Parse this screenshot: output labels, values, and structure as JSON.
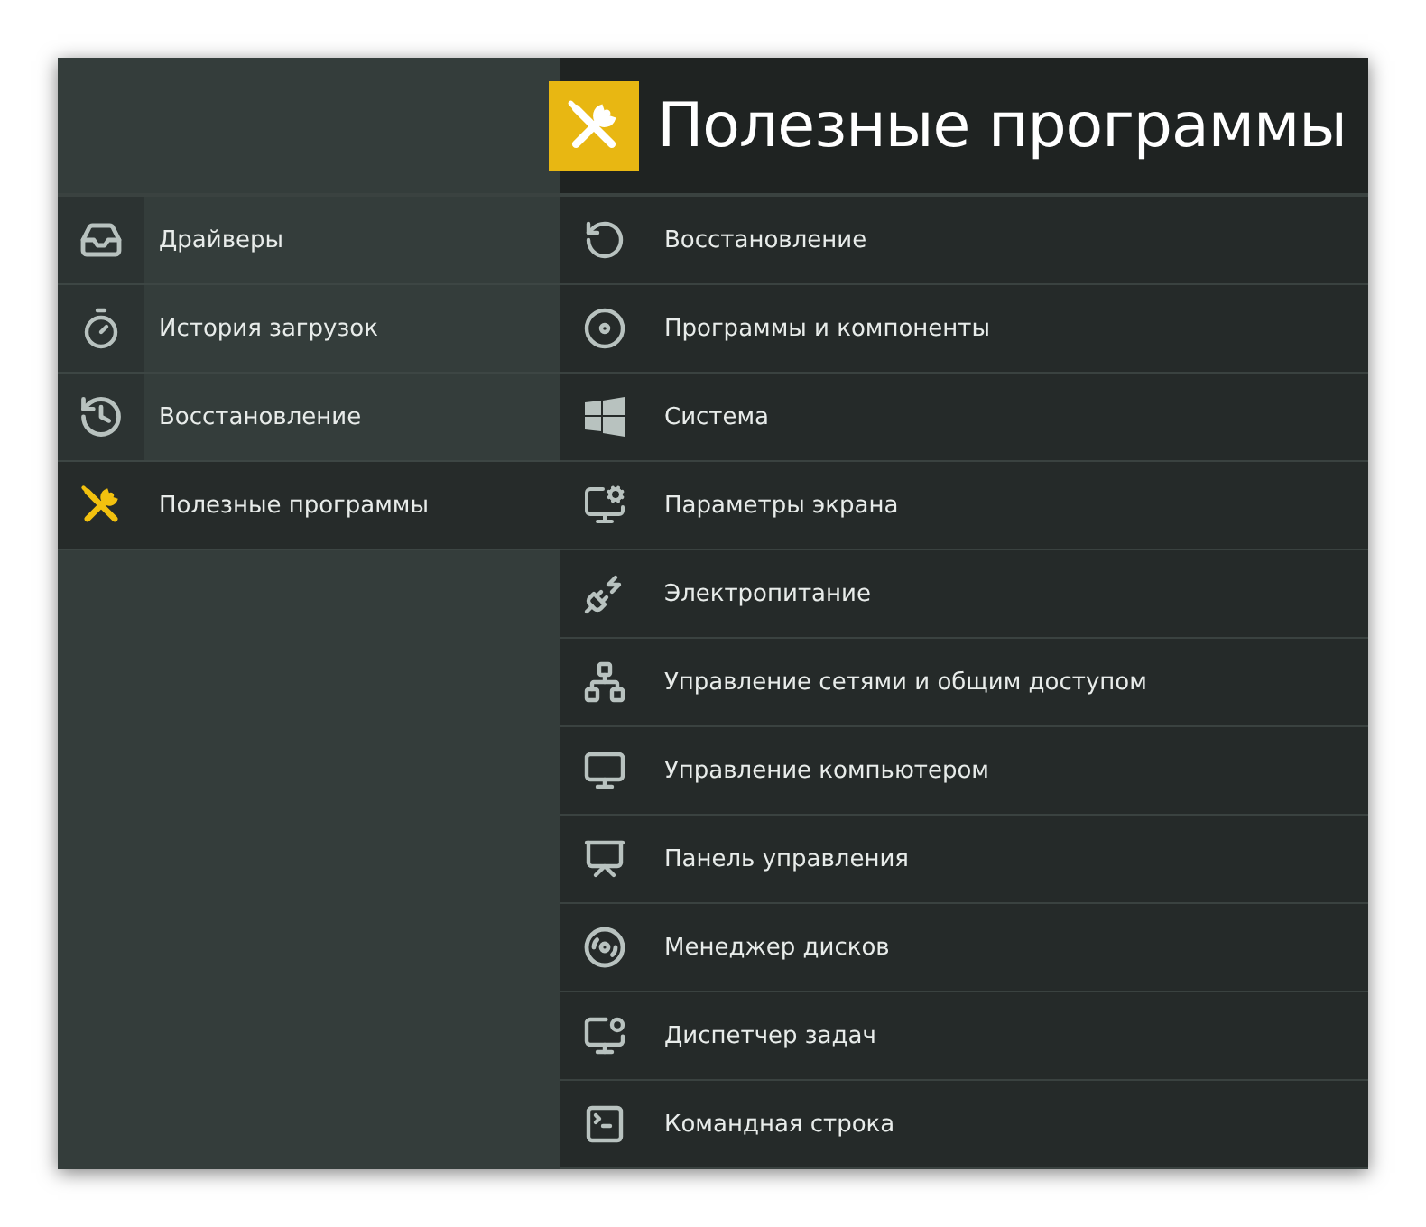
{
  "header": {
    "title": "Полезные программы"
  },
  "sidebar": {
    "items": [
      {
        "label": "Драйверы",
        "selected": false
      },
      {
        "label": "История загрузок",
        "selected": false
      },
      {
        "label": "Восстановление",
        "selected": false
      },
      {
        "label": "Полезные программы",
        "selected": true
      }
    ]
  },
  "tools": [
    {
      "label": "Восстановление"
    },
    {
      "label": "Программы и компоненты"
    },
    {
      "label": "Система"
    },
    {
      "label": "Параметры экрана"
    },
    {
      "label": "Электропитание"
    },
    {
      "label": "Управление сетями и общим доступом"
    },
    {
      "label": "Управление компьютером"
    },
    {
      "label": "Панель управления"
    },
    {
      "label": "Менеджер дисков"
    },
    {
      "label": "Диспетчер задач"
    },
    {
      "label": "Командная строка"
    }
  ]
}
